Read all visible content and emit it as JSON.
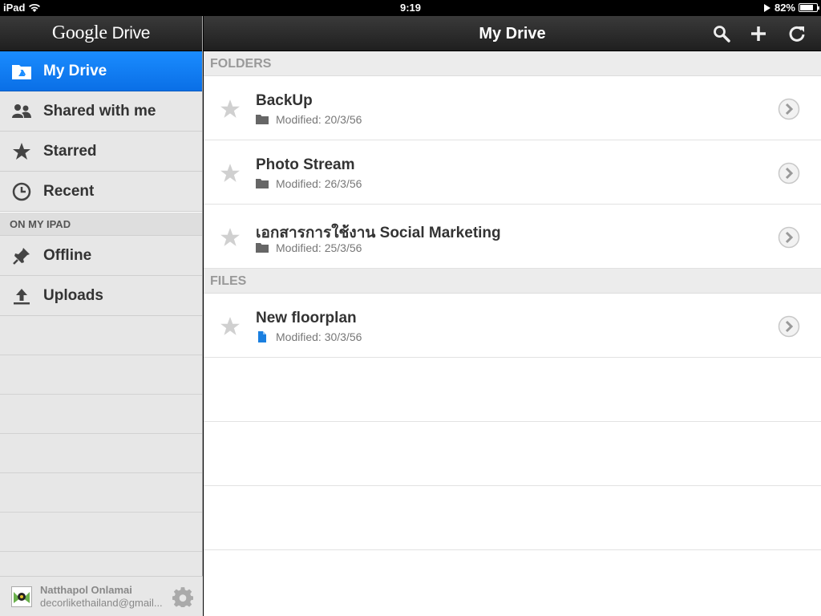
{
  "status_bar": {
    "device": "iPad",
    "time": "9:19",
    "battery_percent": "82%",
    "battery_level": 0.82
  },
  "sidebar": {
    "logo_google": "Google",
    "logo_drive": "Drive",
    "items": [
      {
        "label": "My Drive",
        "icon": "drive-icon",
        "active": true
      },
      {
        "label": "Shared with me",
        "icon": "people-icon",
        "active": false
      },
      {
        "label": "Starred",
        "icon": "star-icon",
        "active": false
      },
      {
        "label": "Recent",
        "icon": "clock-icon",
        "active": false
      }
    ],
    "section_label": "ON MY IPAD",
    "ipad_items": [
      {
        "label": "Offline",
        "icon": "pin-icon"
      },
      {
        "label": "Uploads",
        "icon": "upload-icon"
      }
    ],
    "account": {
      "name": "Natthapol Onlamai",
      "email": "decorlikethailand@gmail..."
    }
  },
  "main": {
    "title": "My Drive",
    "folders_label": "FOLDERS",
    "folders": [
      {
        "name": "BackUp",
        "modified": "Modified: 20/3/56"
      },
      {
        "name": "Photo Stream",
        "modified": "Modified: 26/3/56"
      },
      {
        "name": "เอกสารการใช้งาน Social Marketing",
        "modified": "Modified: 25/3/56"
      }
    ],
    "files_label": "FILES",
    "files": [
      {
        "name": "New floorplan",
        "modified": "Modified: 30/3/56"
      }
    ]
  },
  "colors": {
    "accent": "#1a8cff",
    "header_dark": "#2b2b2b",
    "doc_blue": "#1a7fe0"
  }
}
